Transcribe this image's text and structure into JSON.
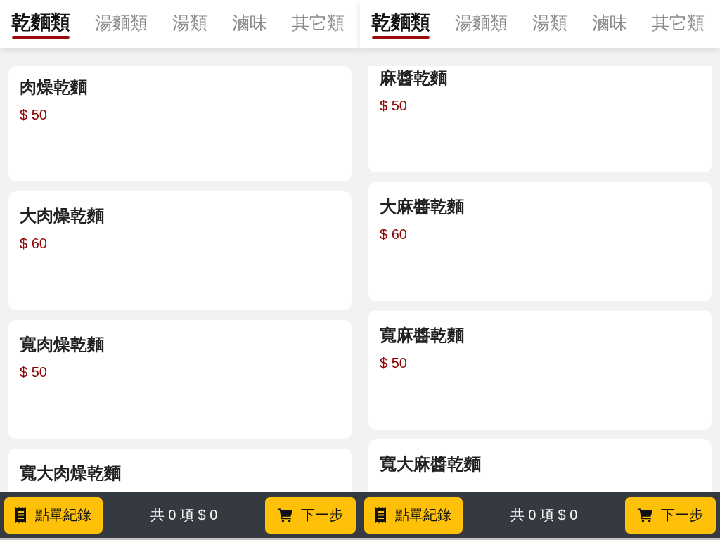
{
  "panes": [
    {
      "tabs": [
        {
          "label": "乾麵類",
          "selected": true
        },
        {
          "label": "湯麵類",
          "selected": false
        },
        {
          "label": "湯類",
          "selected": false
        },
        {
          "label": "滷味",
          "selected": false
        },
        {
          "label": "其它類",
          "selected": false
        }
      ],
      "items": [
        {
          "name": "肉燥乾麵",
          "price": "$ 50"
        },
        {
          "name": "大肉燥乾麵",
          "price": "$ 60"
        },
        {
          "name": "寬肉燥乾麵",
          "price": "$ 50"
        },
        {
          "name": "寬大肉燥乾麵"
        }
      ],
      "bottom_bar": {
        "history_button": "點單紀錄",
        "summary": "共 0 項 $ 0",
        "next_button": "下一步"
      }
    },
    {
      "tabs": [
        {
          "label": "乾麵類",
          "selected": true
        },
        {
          "label": "湯麵類",
          "selected": false
        },
        {
          "label": "湯類",
          "selected": false
        },
        {
          "label": "滷味",
          "selected": false
        },
        {
          "label": "其它類",
          "selected": false
        }
      ],
      "items": [
        {
          "name": "麻醬乾麵",
          "price": "$ 50"
        },
        {
          "name": "大麻醬乾麵",
          "price": "$ 60"
        },
        {
          "name": "寬麻醬乾麵",
          "price": "$ 50"
        },
        {
          "name": "寬大麻醬乾麵"
        }
      ],
      "bottom_bar": {
        "history_button": "點單紀錄",
        "summary": "共 0 項 $ 0",
        "next_button": "下一步"
      }
    }
  ]
}
